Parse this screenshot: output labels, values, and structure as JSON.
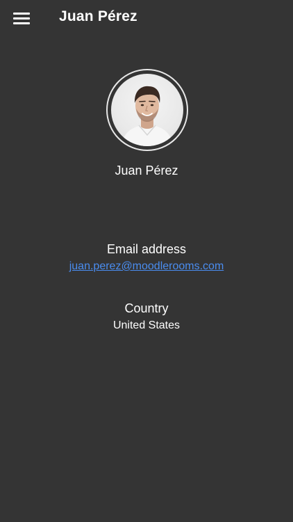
{
  "header": {
    "menu_icon": "hamburger-menu-icon",
    "title": "Juan Pérez"
  },
  "profile": {
    "avatar_icon": "user-avatar",
    "name": "Juan Pérez"
  },
  "details": {
    "email_label": "Email address",
    "email_value": "juan.perez@moodlerooms.com",
    "country_label": "Country",
    "country_value": "United States"
  },
  "colors": {
    "background": "#343434",
    "text": "#ffffff",
    "link": "#4a8df0"
  }
}
